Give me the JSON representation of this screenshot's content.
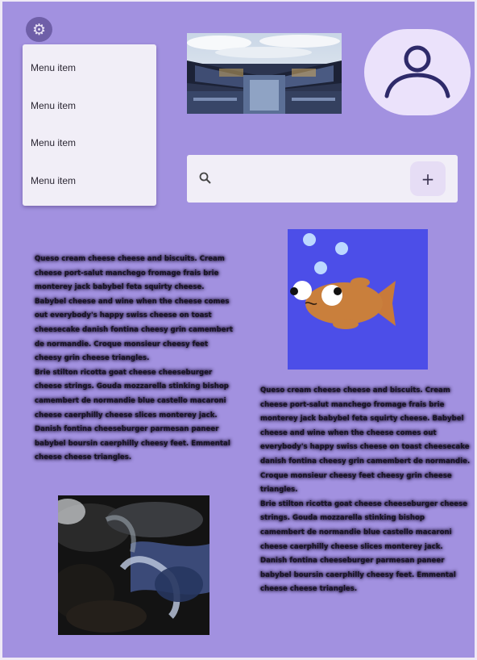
{
  "settings": {
    "icon": "gear-icon"
  },
  "menu": {
    "items": [
      {
        "label": "Menu item"
      },
      {
        "label": "Menu item"
      },
      {
        "label": "Menu item"
      },
      {
        "label": "Menu item"
      }
    ]
  },
  "avatar": {
    "icon": "person-icon"
  },
  "search": {
    "icon": "search-icon",
    "value": "",
    "placeholder": "",
    "action_label": "+"
  },
  "paragraphs": {
    "left": "Queso cream cheese cheese and biscuits. Cream cheese port-salut manchego fromage frais brie monterey jack babybel feta squirty cheese. Babybel cheese and wine when the cheese comes out everybody's happy swiss cheese on toast cheesecake danish fontina cheesy grin camembert de normandie. Croque monsieur cheesy feet cheesy grin cheese triangles.\nBrie stilton ricotta goat cheese cheeseburger cheese strings. Gouda mozzarella stinking bishop camembert de normandie blue castello macaroni cheese caerphilly cheese slices monterey jack. Danish fontina cheeseburger parmesan paneer babybel boursin caerphilly cheesy feet. Emmental cheese cheese triangles.",
    "right": "Queso cream cheese cheese and biscuits. Cream cheese port-salut manchego fromage frais brie monterey jack babybel feta squirty cheese. Babybel cheese and wine when the cheese comes out everybody's happy swiss cheese on toast cheesecake danish fontina cheesy grin camembert de normandie. Croque monsieur cheesy feet cheesy grin cheese triangles.\nBrie stilton ricotta goat cheese cheeseburger cheese strings. Gouda mozzarella stinking bishop camembert de normandie blue castello macaroni cheese caerphilly cheese slices monterey jack. Danish fontina cheeseburger parmesan paneer babybel boursin caerphilly cheesy feet. Emmental cheese cheese triangles."
  },
  "images": {
    "top": "building-photo",
    "fish": "goldfish-illustration",
    "bottom": "water-photo"
  },
  "colors": {
    "background": "#a291e0",
    "surface": "#f1eef7",
    "accent": "#6f5fa8",
    "avatar_bg": "#ebe2fb",
    "fish_bg": "#4c4ee8"
  }
}
